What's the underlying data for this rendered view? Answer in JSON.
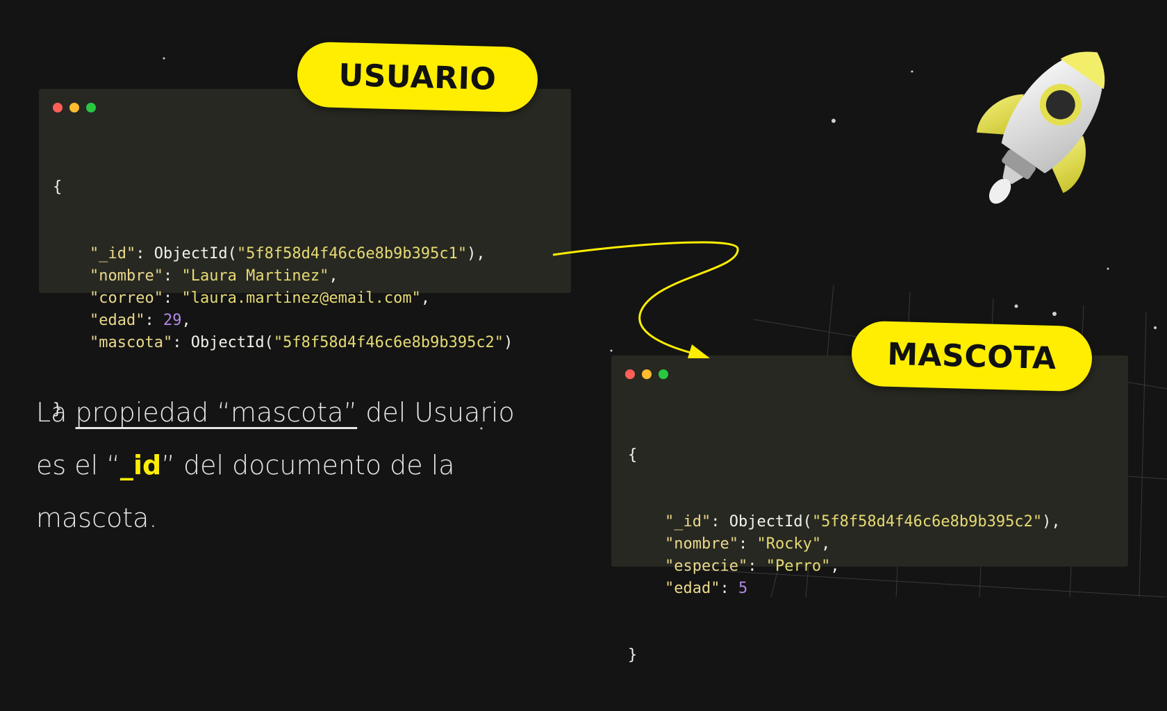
{
  "usuario": {
    "badge": "USUARIO",
    "open_brace": "{",
    "close_brace": "}",
    "fields": [
      {
        "key": "\"_id\"",
        "pre": "ObjectId(",
        "value": "\"5f8f58d4f46c6e8b9b395c1\"",
        "post": "),",
        "type": "str"
      },
      {
        "key": "\"nombre\"",
        "pre": "",
        "value": "\"Laura Martinez\"",
        "post": ",",
        "type": "str"
      },
      {
        "key": "\"correo\"",
        "pre": "",
        "value": "\"laura.martinez@email.com\"",
        "post": ",",
        "type": "str"
      },
      {
        "key": "\"edad\"",
        "pre": "",
        "value": "29",
        "post": ",",
        "type": "num"
      },
      {
        "key": "\"mascota\"",
        "pre": "ObjectId(",
        "value": "\"5f8f58d4f46c6e8b9b395c2\"",
        "post": ")",
        "type": "str"
      }
    ]
  },
  "mascota": {
    "badge": "MASCOTA",
    "open_brace": "{",
    "close_brace": "}",
    "fields": [
      {
        "key": "\"_id\"",
        "pre": "ObjectId(",
        "value": "\"5f8f58d4f46c6e8b9b395c2\"",
        "post": "),",
        "type": "str"
      },
      {
        "key": "\"nombre\"",
        "pre": "",
        "value": "\"Rocky\"",
        "post": ",",
        "type": "str"
      },
      {
        "key": "\"especie\"",
        "pre": "",
        "value": "\"Perro\"",
        "post": ",",
        "type": "str"
      },
      {
        "key": "\"edad\"",
        "pre": "",
        "value": "5",
        "post": "",
        "type": "num"
      }
    ]
  },
  "caption": {
    "part1": "La ",
    "underlined": "propiedad “mascota”",
    "part2": " del Usuario es el “",
    "highlight": "_id",
    "part3": "” del documento de la mascota."
  },
  "colors": {
    "accent": "#ffee00",
    "background": "#141414",
    "card": "#282822",
    "string": "#e6db74",
    "number": "#b08ae0"
  },
  "icons": [
    "window-dots-icon",
    "rocket-icon",
    "arrow-connector-icon"
  ]
}
